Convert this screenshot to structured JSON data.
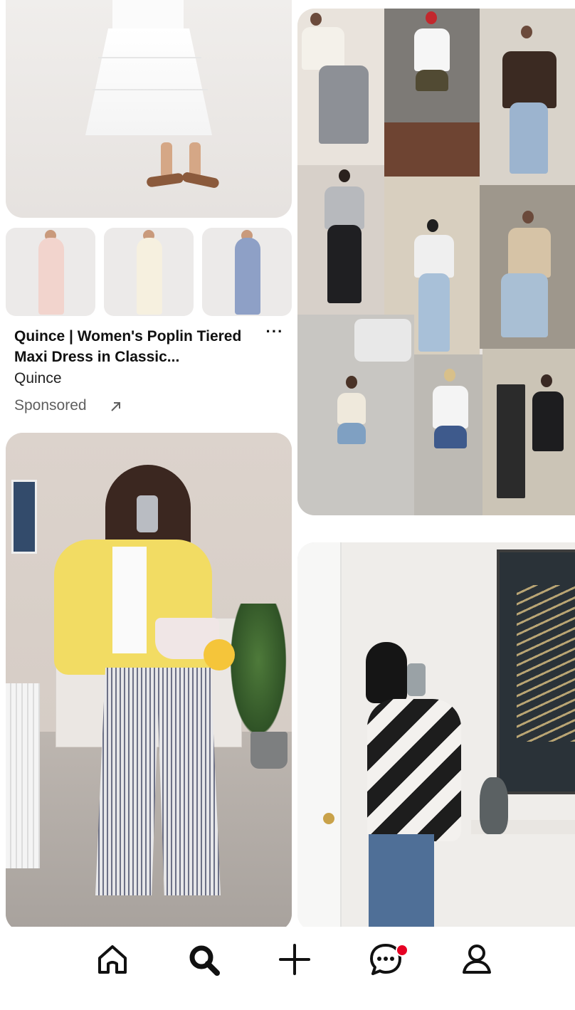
{
  "ad_pin": {
    "title": "Quince | Women's Poplin Tiered Maxi Dress in Classic...",
    "source": "Quince",
    "sponsored_label": "Sponsored",
    "more_label": "···",
    "thumbnails": [
      {
        "name": "pink-dress",
        "color": "#f2d4cd"
      },
      {
        "name": "cream-dress",
        "color": "#f6f0df"
      },
      {
        "name": "blue-striped-dress",
        "color": "#8ea0c6"
      }
    ]
  },
  "nav": {
    "items": [
      {
        "name": "home",
        "icon": "home-icon"
      },
      {
        "name": "search",
        "icon": "search-icon",
        "active": true
      },
      {
        "name": "create",
        "icon": "plus-icon"
      },
      {
        "name": "messages",
        "icon": "chat-icon",
        "has_notification": true
      },
      {
        "name": "profile",
        "icon": "profile-icon"
      }
    ]
  },
  "colors": {
    "notification": "#e60023",
    "text_primary": "#111111",
    "text_secondary": "#5f5f5f"
  }
}
